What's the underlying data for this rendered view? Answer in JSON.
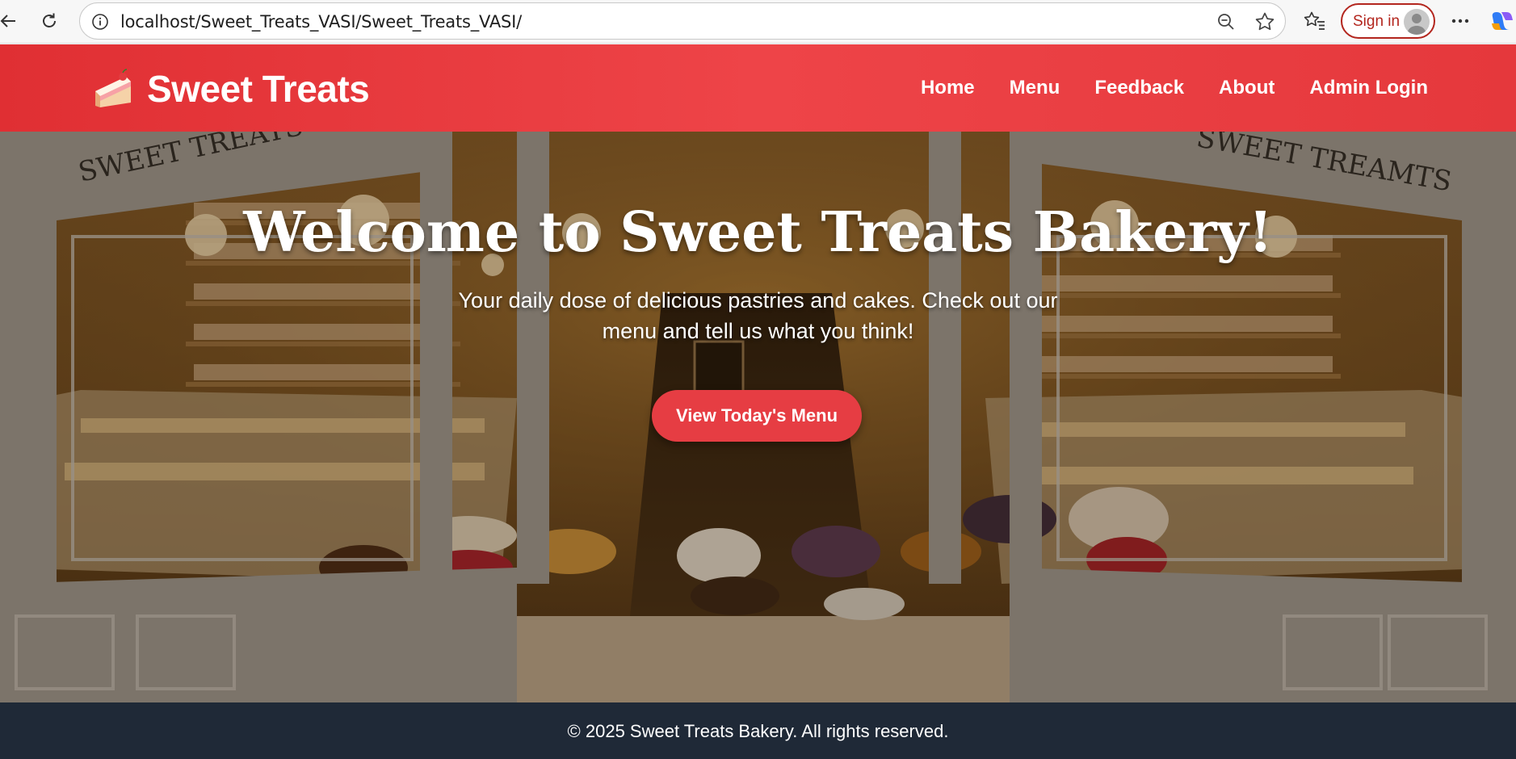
{
  "browser": {
    "url": "localhost/Sweet_Treats_VASI/Sweet_Treats_VASI/",
    "sign_in_label": "Sign in",
    "icons": [
      "back-icon",
      "refresh-icon",
      "info-icon",
      "zoom-out-icon",
      "favorite-star-icon",
      "favorites-list-icon",
      "more-icon",
      "copilot-icon"
    ]
  },
  "header": {
    "brand": "Sweet Treats",
    "nav": [
      "Home",
      "Menu",
      "Feedback",
      "About",
      "Admin Login"
    ]
  },
  "hero": {
    "title": "Welcome to Sweet Treats Bakery!",
    "subtitle": "Your daily dose of delicious pastries and cakes. Check out our menu and tell us what you think!",
    "cta_label": "View Today's Menu",
    "window_lettering": [
      "SWEET TREATS",
      "SWEET TREAMTS"
    ]
  },
  "footer": {
    "text": "© 2025 Sweet Treats Bakery. All rights reserved."
  },
  "colors": {
    "header_red": "#e5383c",
    "cta_red": "#e63d43",
    "footer_navy": "#1f2937",
    "signin_red": "#b3261e"
  }
}
